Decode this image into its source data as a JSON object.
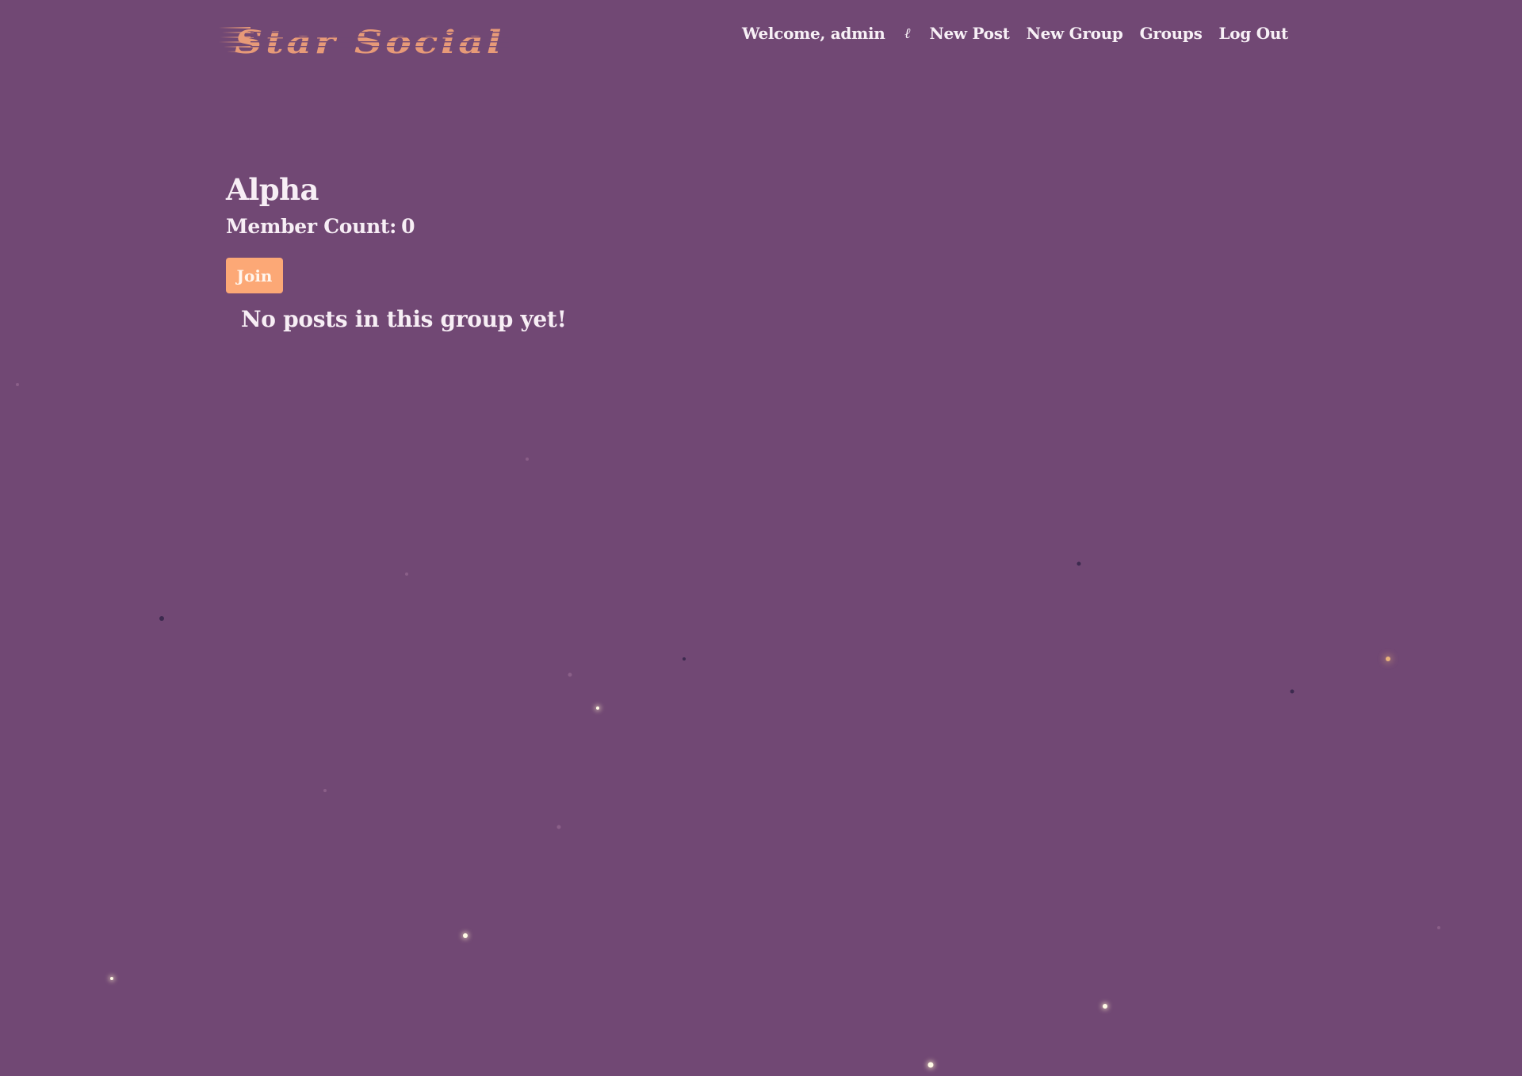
{
  "brand": {
    "name": "Star Social",
    "color": "#e79a78"
  },
  "nav": {
    "welcome": "Welcome, admin",
    "user_icon": "ℓ",
    "new_post": "New Post",
    "new_group": "New Group",
    "groups": "Groups",
    "log_out": "Log Out"
  },
  "group": {
    "name": "Alpha",
    "member_count_label": "Member Count:",
    "member_count": "0",
    "join_label": "Join",
    "empty_message": "No posts in this group yet!"
  },
  "colors": {
    "background": "#714874",
    "accent": "#fca876",
    "text": "#f7eef5"
  }
}
